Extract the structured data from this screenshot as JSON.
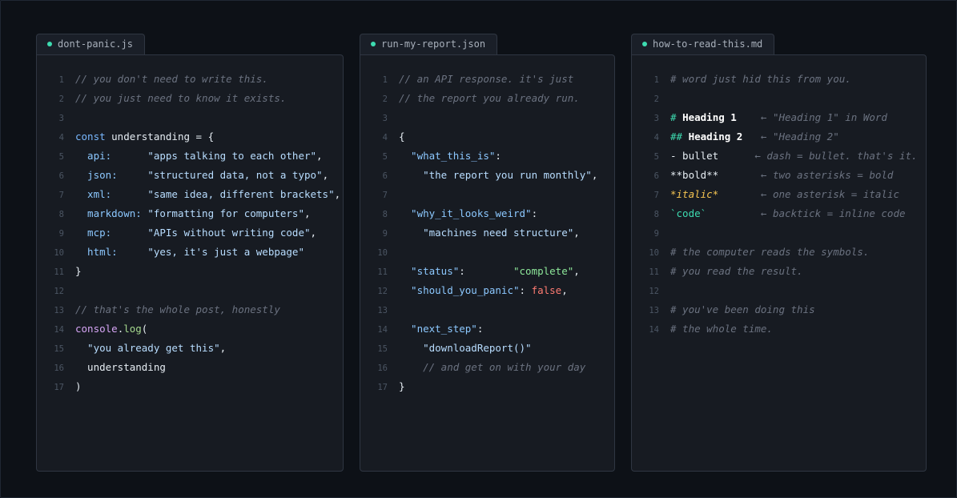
{
  "colors": {
    "background": "#0d1117",
    "panel": "#171b22",
    "accent_dot": "#3ddbb0",
    "comment": "#6b7280",
    "string": "#b8ddff",
    "key": "#8cc8ff",
    "boolean": "#ff7b72",
    "italic": "#f5c451"
  },
  "panels": [
    {
      "tab_label": "dont-panic.js",
      "lines": [
        {
          "n": "1",
          "segs": [
            {
              "c": "cm",
              "t": "// you don't need to write this."
            }
          ]
        },
        {
          "n": "2",
          "segs": [
            {
              "c": "cm",
              "t": "// you just need to know it exists."
            }
          ]
        },
        {
          "n": "3",
          "segs": []
        },
        {
          "n": "4",
          "segs": [
            {
              "c": "kw",
              "t": "const "
            },
            {
              "c": "pl",
              "t": "understanding = {"
            }
          ]
        },
        {
          "n": "5",
          "segs": [
            {
              "c": "key",
              "t": "  api:      "
            },
            {
              "c": "str",
              "t": "\"apps talking to each other\""
            },
            {
              "c": "pl",
              "t": ","
            }
          ]
        },
        {
          "n": "6",
          "segs": [
            {
              "c": "key",
              "t": "  json:     "
            },
            {
              "c": "str",
              "t": "\"structured data, not a typo\""
            },
            {
              "c": "pl",
              "t": ","
            }
          ]
        },
        {
          "n": "7",
          "segs": [
            {
              "c": "key",
              "t": "  xml:      "
            },
            {
              "c": "str",
              "t": "\"same idea, different brackets\""
            },
            {
              "c": "pl",
              "t": ","
            }
          ]
        },
        {
          "n": "8",
          "segs": [
            {
              "c": "key",
              "t": "  markdown: "
            },
            {
              "c": "str",
              "t": "\"formatting for computers\""
            },
            {
              "c": "pl",
              "t": ","
            }
          ]
        },
        {
          "n": "9",
          "segs": [
            {
              "c": "key",
              "t": "  mcp:      "
            },
            {
              "c": "str",
              "t": "\"APIs without writing code\""
            },
            {
              "c": "pl",
              "t": ","
            }
          ]
        },
        {
          "n": "10",
          "segs": [
            {
              "c": "key",
              "t": "  html:     "
            },
            {
              "c": "str",
              "t": "\"yes, it's just a webpage\""
            }
          ]
        },
        {
          "n": "11",
          "segs": [
            {
              "c": "pl",
              "t": "}"
            }
          ]
        },
        {
          "n": "12",
          "segs": []
        },
        {
          "n": "13",
          "segs": [
            {
              "c": "cm",
              "t": "// that's the whole post, honestly"
            }
          ]
        },
        {
          "n": "14",
          "segs": [
            {
              "c": "cs",
              "t": "console"
            },
            {
              "c": "pl",
              "t": "."
            },
            {
              "c": "fn",
              "t": "log"
            },
            {
              "c": "pl",
              "t": "("
            }
          ]
        },
        {
          "n": "15",
          "segs": [
            {
              "c": "str",
              "t": "  \"you already get this\""
            },
            {
              "c": "pl",
              "t": ","
            }
          ]
        },
        {
          "n": "16",
          "segs": [
            {
              "c": "pl",
              "t": "  understanding"
            }
          ]
        },
        {
          "n": "17",
          "segs": [
            {
              "c": "pl",
              "t": ")"
            }
          ]
        }
      ]
    },
    {
      "tab_label": "run-my-report.json",
      "lines": [
        {
          "n": "1",
          "segs": [
            {
              "c": "cm",
              "t": "// an API response. it's just"
            }
          ]
        },
        {
          "n": "2",
          "segs": [
            {
              "c": "cm",
              "t": "// the report you already run."
            }
          ]
        },
        {
          "n": "3",
          "segs": []
        },
        {
          "n": "4",
          "segs": [
            {
              "c": "pl",
              "t": "{"
            }
          ]
        },
        {
          "n": "5",
          "segs": [
            {
              "c": "key",
              "t": "  \"what_this_is\""
            },
            {
              "c": "pl",
              "t": ":"
            }
          ]
        },
        {
          "n": "6",
          "segs": [
            {
              "c": "str",
              "t": "    \"the report you run monthly\""
            },
            {
              "c": "pl",
              "t": ","
            }
          ]
        },
        {
          "n": "7",
          "segs": []
        },
        {
          "n": "8",
          "segs": [
            {
              "c": "key",
              "t": "  \"why_it_looks_weird\""
            },
            {
              "c": "pl",
              "t": ":"
            }
          ]
        },
        {
          "n": "9",
          "segs": [
            {
              "c": "str",
              "t": "    \"machines need structure\""
            },
            {
              "c": "pl",
              "t": ","
            }
          ]
        },
        {
          "n": "10",
          "segs": []
        },
        {
          "n": "11",
          "segs": [
            {
              "c": "key",
              "t": "  \"status\""
            },
            {
              "c": "pl",
              "t": ":        "
            },
            {
              "c": "gs",
              "t": "\"complete\""
            },
            {
              "c": "pl",
              "t": ","
            }
          ]
        },
        {
          "n": "12",
          "segs": [
            {
              "c": "key",
              "t": "  \"should_you_panic\""
            },
            {
              "c": "pl",
              "t": ": "
            },
            {
              "c": "bool",
              "t": "false"
            },
            {
              "c": "pl",
              "t": ","
            }
          ]
        },
        {
          "n": "13",
          "segs": []
        },
        {
          "n": "14",
          "segs": [
            {
              "c": "key",
              "t": "  \"next_step\""
            },
            {
              "c": "pl",
              "t": ":"
            }
          ]
        },
        {
          "n": "15",
          "segs": [
            {
              "c": "str",
              "t": "    \"downloadReport()\""
            }
          ]
        },
        {
          "n": "16",
          "segs": [
            {
              "c": "cm",
              "t": "    // and get on with your day"
            }
          ]
        },
        {
          "n": "17",
          "segs": [
            {
              "c": "pl",
              "t": "}"
            }
          ]
        }
      ]
    },
    {
      "tab_label": "how-to-read-this.md",
      "lines": [
        {
          "n": "1",
          "segs": [
            {
              "c": "cm",
              "t": "# word just hid this from you."
            }
          ]
        },
        {
          "n": "2",
          "segs": []
        },
        {
          "n": "3",
          "segs": [
            {
              "c": "h",
              "t": "# "
            },
            {
              "c": "hd",
              "t": "Heading 1"
            },
            {
              "c": "pl",
              "t": "    "
            },
            {
              "c": "cm",
              "t": "← \"Heading 1\" in Word"
            }
          ]
        },
        {
          "n": "4",
          "segs": [
            {
              "c": "h",
              "t": "## "
            },
            {
              "c": "hd",
              "t": "Heading 2"
            },
            {
              "c": "pl",
              "t": "   "
            },
            {
              "c": "cm",
              "t": "← \"Heading 2\""
            }
          ]
        },
        {
          "n": "5",
          "segs": [
            {
              "c": "pl",
              "t": "- bullet      "
            },
            {
              "c": "cm",
              "t": "← dash = bullet. that's it."
            }
          ]
        },
        {
          "n": "6",
          "segs": [
            {
              "c": "pl",
              "t": "**bold**       "
            },
            {
              "c": "cm",
              "t": "← two asterisks = bold"
            }
          ]
        },
        {
          "n": "7",
          "segs": [
            {
              "c": "it",
              "t": "*italic*"
            },
            {
              "c": "pl",
              "t": "       "
            },
            {
              "c": "cm",
              "t": "← one asterisk = italic"
            }
          ]
        },
        {
          "n": "8",
          "segs": [
            {
              "c": "ic",
              "t": "`code`"
            },
            {
              "c": "pl",
              "t": "         "
            },
            {
              "c": "cm",
              "t": "← backtick = inline code"
            }
          ]
        },
        {
          "n": "9",
          "segs": []
        },
        {
          "n": "10",
          "segs": [
            {
              "c": "cm",
              "t": "# the computer reads the symbols."
            }
          ]
        },
        {
          "n": "11",
          "segs": [
            {
              "c": "cm",
              "t": "# you read the result."
            }
          ]
        },
        {
          "n": "12",
          "segs": []
        },
        {
          "n": "13",
          "segs": [
            {
              "c": "cm",
              "t": "# you've been doing this"
            }
          ]
        },
        {
          "n": "14",
          "segs": [
            {
              "c": "cm",
              "t": "# the whole time."
            }
          ]
        }
      ]
    }
  ]
}
